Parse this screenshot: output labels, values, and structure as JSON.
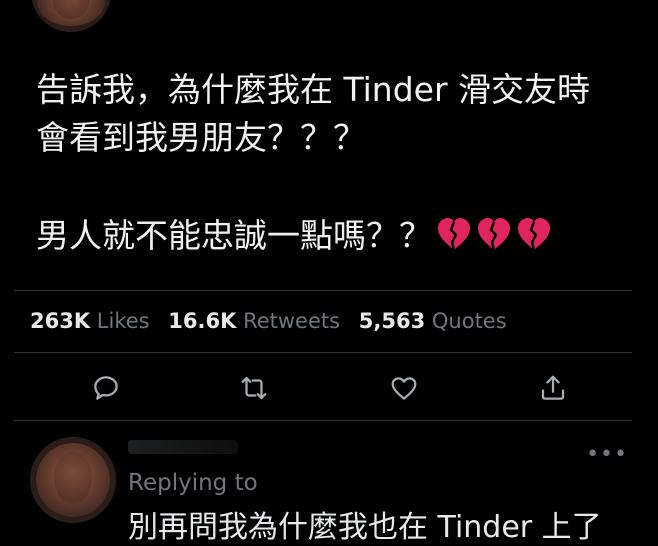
{
  "tweet": {
    "lines": [
      "告訴我，為什麼我在 Tinder 滑交友時",
      "會看到我男朋友？？？",
      "男人就不能忠誠一點嗎？？"
    ],
    "emoji_count": 3,
    "emoji_icon": "broken-heart-icon"
  },
  "stats": {
    "likes_value": "263K",
    "likes_label": "Likes",
    "retweets_value": "16.6K",
    "retweets_label": "Retweets",
    "quotes_value": "5,563",
    "quotes_label": "Quotes"
  },
  "actions": [
    {
      "name": "reply",
      "icon": "comment-icon"
    },
    {
      "name": "retweet",
      "icon": "retweet-icon"
    },
    {
      "name": "like",
      "icon": "heart-icon"
    },
    {
      "name": "share",
      "icon": "share-icon"
    }
  ],
  "reply": {
    "more": "•••",
    "replying_to_label": "Replying to",
    "preview_text": "別再問我為什麼我也在 Tinder 上了"
  },
  "colors": {
    "background": "#000000",
    "text": "#e7e9ea",
    "muted": "#71767b",
    "divider": "#2f3336",
    "broken_heart": "#e0245e"
  }
}
